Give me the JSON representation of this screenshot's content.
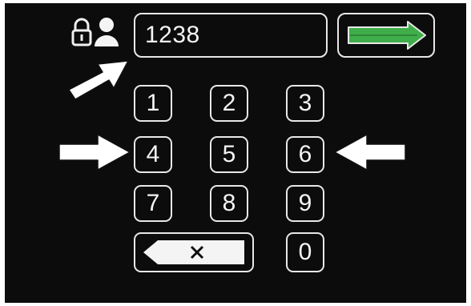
{
  "pin": {
    "value": "1238"
  },
  "keypad": {
    "keys": [
      "1",
      "2",
      "3",
      "4",
      "5",
      "6",
      "7",
      "8",
      "9",
      "0"
    ]
  },
  "icons": {
    "lock": "lock-icon",
    "user": "user-icon",
    "enter": "right-arrow-icon",
    "backspace": "backspace-icon"
  },
  "colors": {
    "background": "#0c0c0c",
    "outline": "#e8e8e8",
    "enter_green": "#3fae4a",
    "annotation_arrow": "#ffffff"
  }
}
